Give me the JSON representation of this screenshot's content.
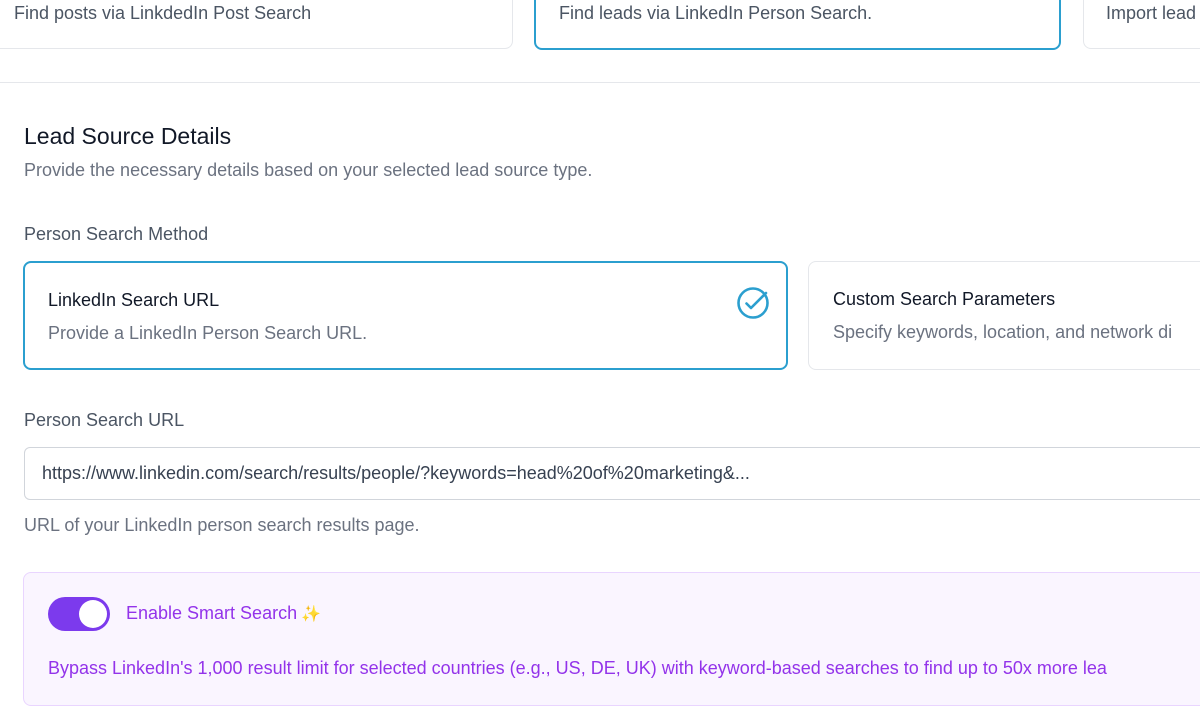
{
  "source_types": {
    "post_search": "Find posts via LinkdedIn Post Search",
    "person_search": "Find leads via LinkedIn Person Search.",
    "import": "Import lead"
  },
  "section": {
    "title": "Lead Source Details",
    "subtitle": "Provide the necessary details based on your selected lead source type."
  },
  "method": {
    "label": "Person Search Method",
    "options": [
      {
        "title": "LinkedIn Search URL",
        "description": "Provide a LinkedIn Person Search URL.",
        "selected": true
      },
      {
        "title": "Custom Search Parameters",
        "description": "Specify keywords, location, and network di",
        "selected": false
      }
    ]
  },
  "url_field": {
    "label": "Person Search URL",
    "value": "https://www.linkedin.com/search/results/people/?keywords=head%20of%20marketing&...",
    "hint": "URL of your LinkedIn person search results page."
  },
  "smart_search": {
    "enabled": true,
    "label": "Enable Smart Search",
    "sparkle": "✨",
    "description": "Bypass LinkedIn's 1,000 result limit for selected countries (e.g., US, DE, UK) with keyword-based searches to find up to 50x more lea"
  },
  "colors": {
    "accent": "#2b9fcf",
    "toggle_on": "#7c3aed",
    "smart_text": "#9333ea",
    "smart_bg": "#faf5ff"
  },
  "icons": {
    "selected": "check-circle-icon",
    "sparkle": "sparkles-icon"
  }
}
